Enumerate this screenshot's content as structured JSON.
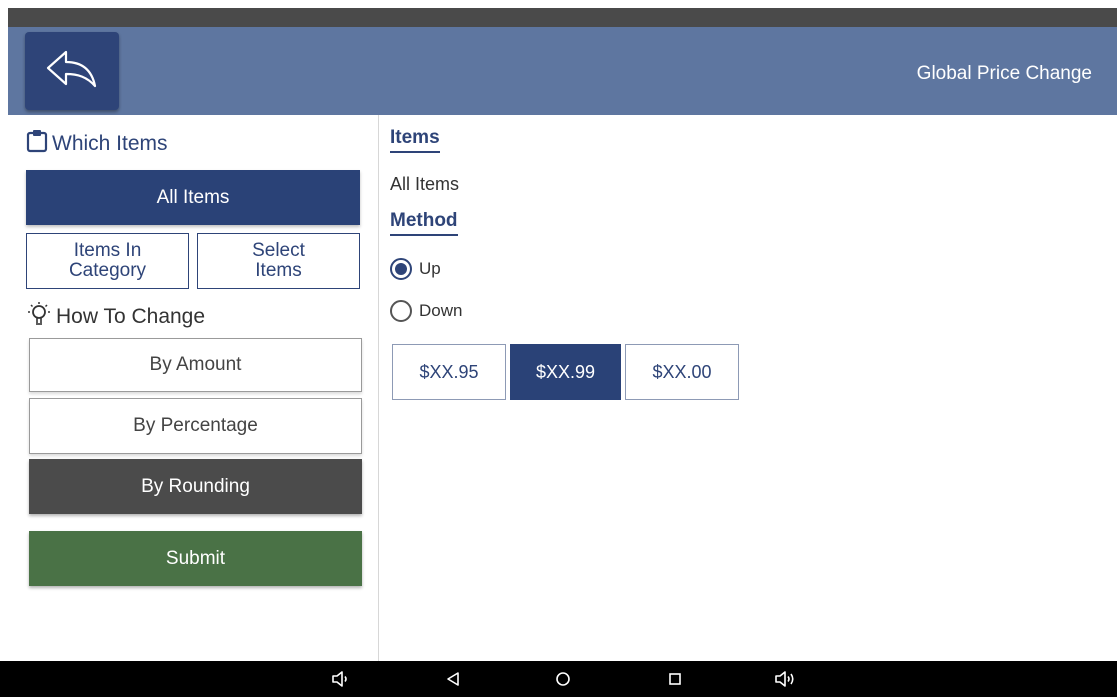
{
  "header": {
    "title": "Global Price Change",
    "back_icon": "reply-arrow-icon"
  },
  "which_items": {
    "label": "Which Items",
    "icon": "clipboard-icon",
    "all_items": "All Items",
    "items_in_category_line1": "Items In",
    "items_in_category_line2": "Category",
    "select_items_line1": "Select",
    "select_items_line2": "Items"
  },
  "how_to_change": {
    "label": "How To Change",
    "icon": "lightbulb-icon",
    "by_amount": "By Amount",
    "by_percentage": "By Percentage",
    "by_rounding": "By Rounding",
    "selected": "By Rounding"
  },
  "submit": "Submit",
  "detail": {
    "items_heading": "Items",
    "items_value": "All Items",
    "method_heading": "Method",
    "method_options": [
      "Up",
      "Down"
    ],
    "method_selected": "Up",
    "rounding_options": [
      "$XX.95",
      "$XX.99",
      "$XX.00"
    ],
    "rounding_selected": "$XX.99"
  },
  "colors": {
    "header_bg": "#5e76a0",
    "primary": "#2a4277",
    "selected_dark": "#4b4b4b",
    "submit_green": "#4a7246"
  },
  "navbar": {
    "icons": [
      "volume-down-icon",
      "back-triangle-icon",
      "home-circle-icon",
      "recents-square-icon",
      "volume-up-icon"
    ]
  }
}
